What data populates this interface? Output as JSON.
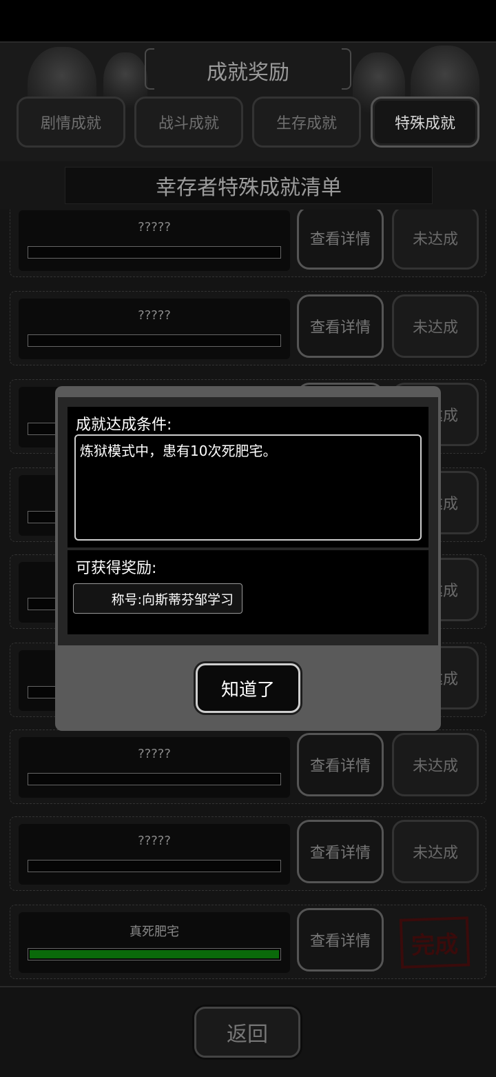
{
  "header": {
    "title": "成就奖励",
    "tabs": [
      {
        "label": "剧情成就",
        "active": false
      },
      {
        "label": "战斗成就",
        "active": false
      },
      {
        "label": "生存成就",
        "active": false
      },
      {
        "label": "特殊成就",
        "active": true
      }
    ]
  },
  "subtitle": "幸存者特殊成就清单",
  "list": {
    "detail_label": "查看详情",
    "rows": [
      {
        "name": "?????",
        "status": "未达成",
        "progress": 0
      },
      {
        "name": "?????",
        "status": "未达成",
        "progress": 0
      },
      {
        "name": "",
        "status": "未达成",
        "progress": 0
      },
      {
        "name": "",
        "status": "未达成",
        "progress": 0
      },
      {
        "name": "",
        "status": "未达成",
        "progress": 0
      },
      {
        "name": "",
        "status": "未达成",
        "progress": 0
      },
      {
        "name": "?????",
        "status": "未达成",
        "progress": 0
      },
      {
        "name": "?????",
        "status": "未达成",
        "progress": 0
      },
      {
        "name": "真死肥宅",
        "status": "完成",
        "progress": 1
      }
    ]
  },
  "footer": {
    "back_label": "返回"
  },
  "dialog": {
    "condition_label": "成就达成条件:",
    "condition_text": "炼狱模式中，患有10次死肥宅。",
    "reward_label": "可获得奖励:",
    "reward_item": "称号:向斯蒂芬邹学习",
    "ok_label": "知道了"
  },
  "colors": {
    "progress_fill": "#0a6a0a",
    "stamp": "#3a0b0b"
  }
}
